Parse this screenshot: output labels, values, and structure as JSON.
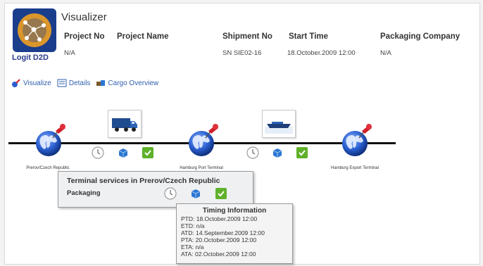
{
  "app": {
    "title": "Visualizer",
    "logo_text": "Logit D2D"
  },
  "header": {
    "columns": [
      "Project No",
      "Project Name",
      "Shipment No",
      "Start Time",
      "Packaging Company"
    ],
    "values": {
      "project_no": "N/A",
      "shipment_no": "SN SIE02-16",
      "start_time": "18.October.2009 12:00",
      "packaging_company": "N/A"
    }
  },
  "tabs": [
    {
      "label": "Visualize",
      "icon": "visualize-icon"
    },
    {
      "label": "Details",
      "icon": "details-icon"
    },
    {
      "label": "Cargo Overview",
      "icon": "cargo-icon"
    }
  ],
  "timeline": {
    "nodes": [
      {
        "label": "Prerov/Czech Republic",
        "icon": "globe-icon"
      },
      {
        "label": "Hamburg Port Terminal",
        "icon": "globe-icon"
      },
      {
        "label": "Hamburg Export Terminal",
        "icon": "globe-icon"
      }
    ],
    "vehicles": [
      {
        "type": "truck",
        "icon": "truck-icon"
      },
      {
        "type": "ship",
        "icon": "ship-icon"
      }
    ],
    "status_icons": [
      "clock-icon",
      "cube-icon",
      "check-icon"
    ]
  },
  "terminal_tooltip": {
    "title": "Terminal services in Prerov/Czech Republic",
    "subtitle": "Packaging"
  },
  "timing_tooltip": {
    "title": "Timing Information",
    "rows": [
      "PTD: 18.October.2009 12:00",
      "ETD: n/a",
      "ATD: 14.September.2009 12:00",
      "PTA: 20.October.2009 12:00",
      "ETA: n/a",
      "ATA: 02.October.2009 12:00"
    ]
  },
  "colors": {
    "link": "#2f5fae",
    "globe": "#1f56c8",
    "pin": "#d0202a",
    "check": "#5fb12a",
    "logo_bg": "#1a3e8c",
    "logo_dots": "#f0a020"
  }
}
